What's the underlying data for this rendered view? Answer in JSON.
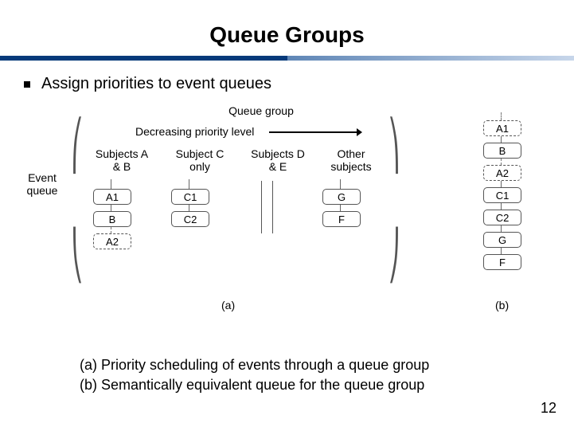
{
  "title": "Queue Groups",
  "bullet": "Assign priorities to event queues",
  "diagram": {
    "top_label": "Queue group",
    "priority_label": "Decreasing priority level",
    "event_queue_label": "Event\nqueue",
    "columns": [
      {
        "header": "Subjects\nA & B",
        "cells": [
          "A1",
          "B",
          "A2"
        ]
      },
      {
        "header": "Subject\nC only",
        "cells": [
          "C1",
          "C2"
        ]
      },
      {
        "header": "Subjects\nD & E",
        "cells": []
      },
      {
        "header": "Other\nsubjects",
        "cells": [
          "G",
          "F"
        ]
      }
    ],
    "right_stack": [
      "A1",
      "B",
      "A2",
      "C1",
      "C2",
      "G",
      "F"
    ],
    "sub_a": "(a)",
    "sub_b": "(b)"
  },
  "captions": {
    "a": "(a) Priority scheduling of events through a queue group",
    "b": "(b) Semantically equivalent queue for the queue group"
  },
  "page_number": "12"
}
